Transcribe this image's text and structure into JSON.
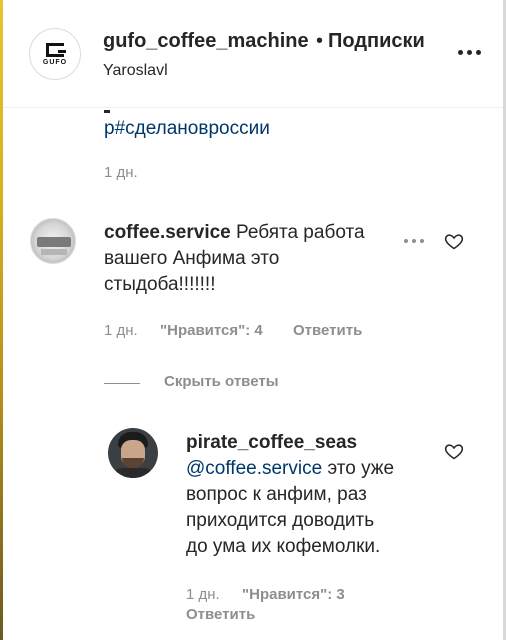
{
  "header": {
    "logo_text": "GUFO",
    "username": "gufo_coffee_machine",
    "separator": "•",
    "follow_label": "Подписки",
    "location": "Yaroslavl"
  },
  "caption": {
    "hashtag": "р#сделановроссии",
    "time": "1 дн."
  },
  "comments": [
    {
      "username": "coffee.service",
      "text": "Ребята работа вашего Анфима это стыдоба!!!!!!!",
      "lines": [
        "Ребята работа",
        "вашего Анфима это",
        "стыдоба!!!!!!!"
      ],
      "time": "1 дн.",
      "likes": "\"Нравится\": 4",
      "reply_label": "Ответить",
      "hide_replies_label": "Скрыть ответы"
    },
    {
      "username": "pirate_coffee_seas",
      "mention": "@coffee.service",
      "lines": [
        "это уже",
        "вопрос к анфим, раз",
        "приходится доводить",
        "до ума их кофемолки."
      ],
      "time": "1 дн.",
      "likes": "\"Нравится\": 3",
      "reply_label": "Ответить"
    }
  ],
  "icons": {
    "header_more": "more-horizontal-icon",
    "comment_more": "more-horizontal-icon",
    "like": "heart-outline-icon"
  }
}
